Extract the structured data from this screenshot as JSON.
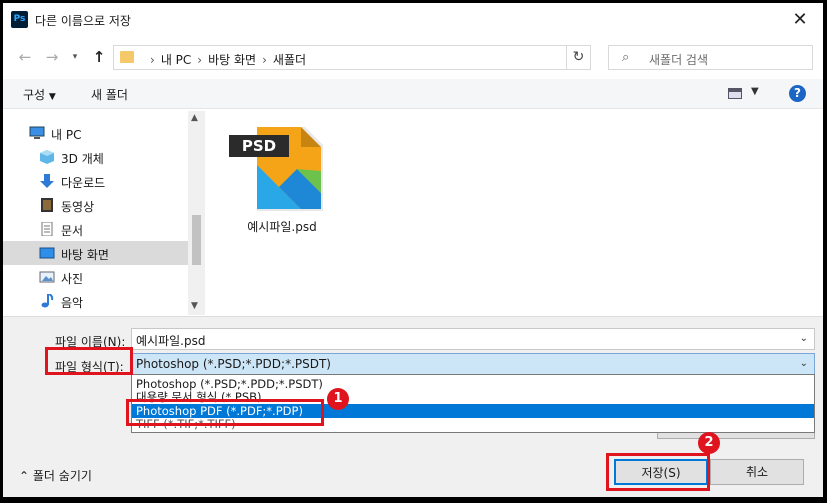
{
  "window": {
    "title": "다른 이름으로 저장",
    "app_icon": "Ps"
  },
  "addressbar": {
    "crumbs": [
      "내 PC",
      "바탕 화면",
      "새폴더"
    ],
    "search_placeholder": "새폴더 검색"
  },
  "toolbar": {
    "organize": "구성",
    "new_folder": "새 폴더"
  },
  "navpane": {
    "items": [
      {
        "label": "내 PC",
        "icon": "pc-icon"
      },
      {
        "label": "3D 개체",
        "icon": "3d-objects-icon"
      },
      {
        "label": "다운로드",
        "icon": "download-icon"
      },
      {
        "label": "동영상",
        "icon": "video-icon"
      },
      {
        "label": "문서",
        "icon": "document-icon"
      },
      {
        "label": "바탕 화면",
        "icon": "desktop-icon",
        "selected": true
      },
      {
        "label": "사진",
        "icon": "pictures-icon"
      },
      {
        "label": "음악",
        "icon": "music-icon"
      }
    ]
  },
  "files": [
    {
      "name": "예시파일.psd",
      "badge": "PSD"
    }
  ],
  "form": {
    "filename_label": "파일 이름(N):",
    "filename_value": "예시파일.psd",
    "filetype_label": "파일 형식(T):",
    "filetype_value": "Photoshop (*.PSD;*.PDD;*.PSDT)",
    "options": [
      "Photoshop (*.PSD;*.PDD;*.PSDT)",
      "대용량 문서 형식 (*.PSB)",
      "Photoshop PDF (*.PDF;*.PDP)",
      "TIFF (*.TIF;*.TIFF)"
    ],
    "selected_option_index": 2
  },
  "footer": {
    "hide_folders": "폴더 숨기기",
    "save": "저장(S)",
    "cancel": "취소"
  },
  "callouts": {
    "badge1": "1",
    "badge2": "2",
    "color": "#e0141e"
  },
  "colors": {
    "accent": "#0078d7",
    "selection": "#cde6f7"
  }
}
